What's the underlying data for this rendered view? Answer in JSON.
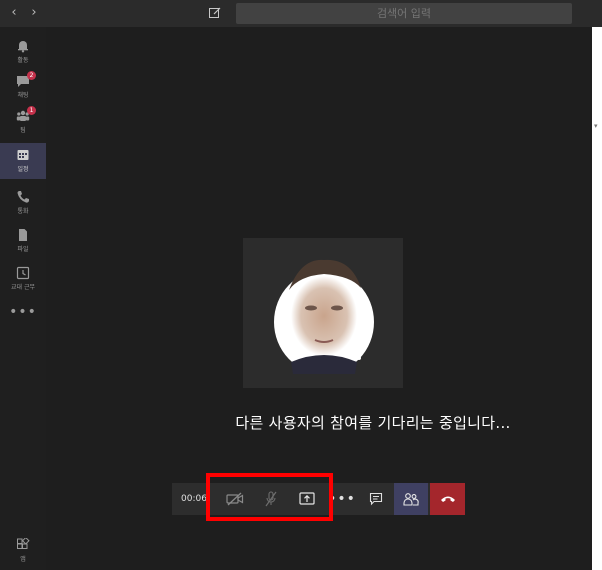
{
  "topbar": {
    "back_label": "‹",
    "forward_label": "›",
    "search": {
      "placeholder": "검색어 입력"
    }
  },
  "sidebar": {
    "items": [
      {
        "label": "활동",
        "icon": "bell-icon",
        "badge": ""
      },
      {
        "label": "채팅",
        "icon": "chat-icon",
        "badge": "2"
      },
      {
        "label": "팀",
        "icon": "teams-icon",
        "badge": "1"
      },
      {
        "label": "일정",
        "icon": "calendar-icon",
        "badge": ""
      },
      {
        "label": "통화",
        "icon": "phone-icon",
        "badge": ""
      },
      {
        "label": "파일",
        "icon": "file-icon",
        "badge": ""
      },
      {
        "label": "교대 근무",
        "icon": "shifts-icon",
        "badge": ""
      }
    ],
    "more_label": "•••",
    "apps_label": "앱"
  },
  "call": {
    "waiting_message": "다른 사용자의 참여를 기다리는 중입니다...",
    "timer": "00:06",
    "more_label": "•••"
  },
  "colors": {
    "accent": "#3f4062",
    "hangup": "#a4262c",
    "highlight": "#ff0000",
    "badge": "#c4314b"
  }
}
